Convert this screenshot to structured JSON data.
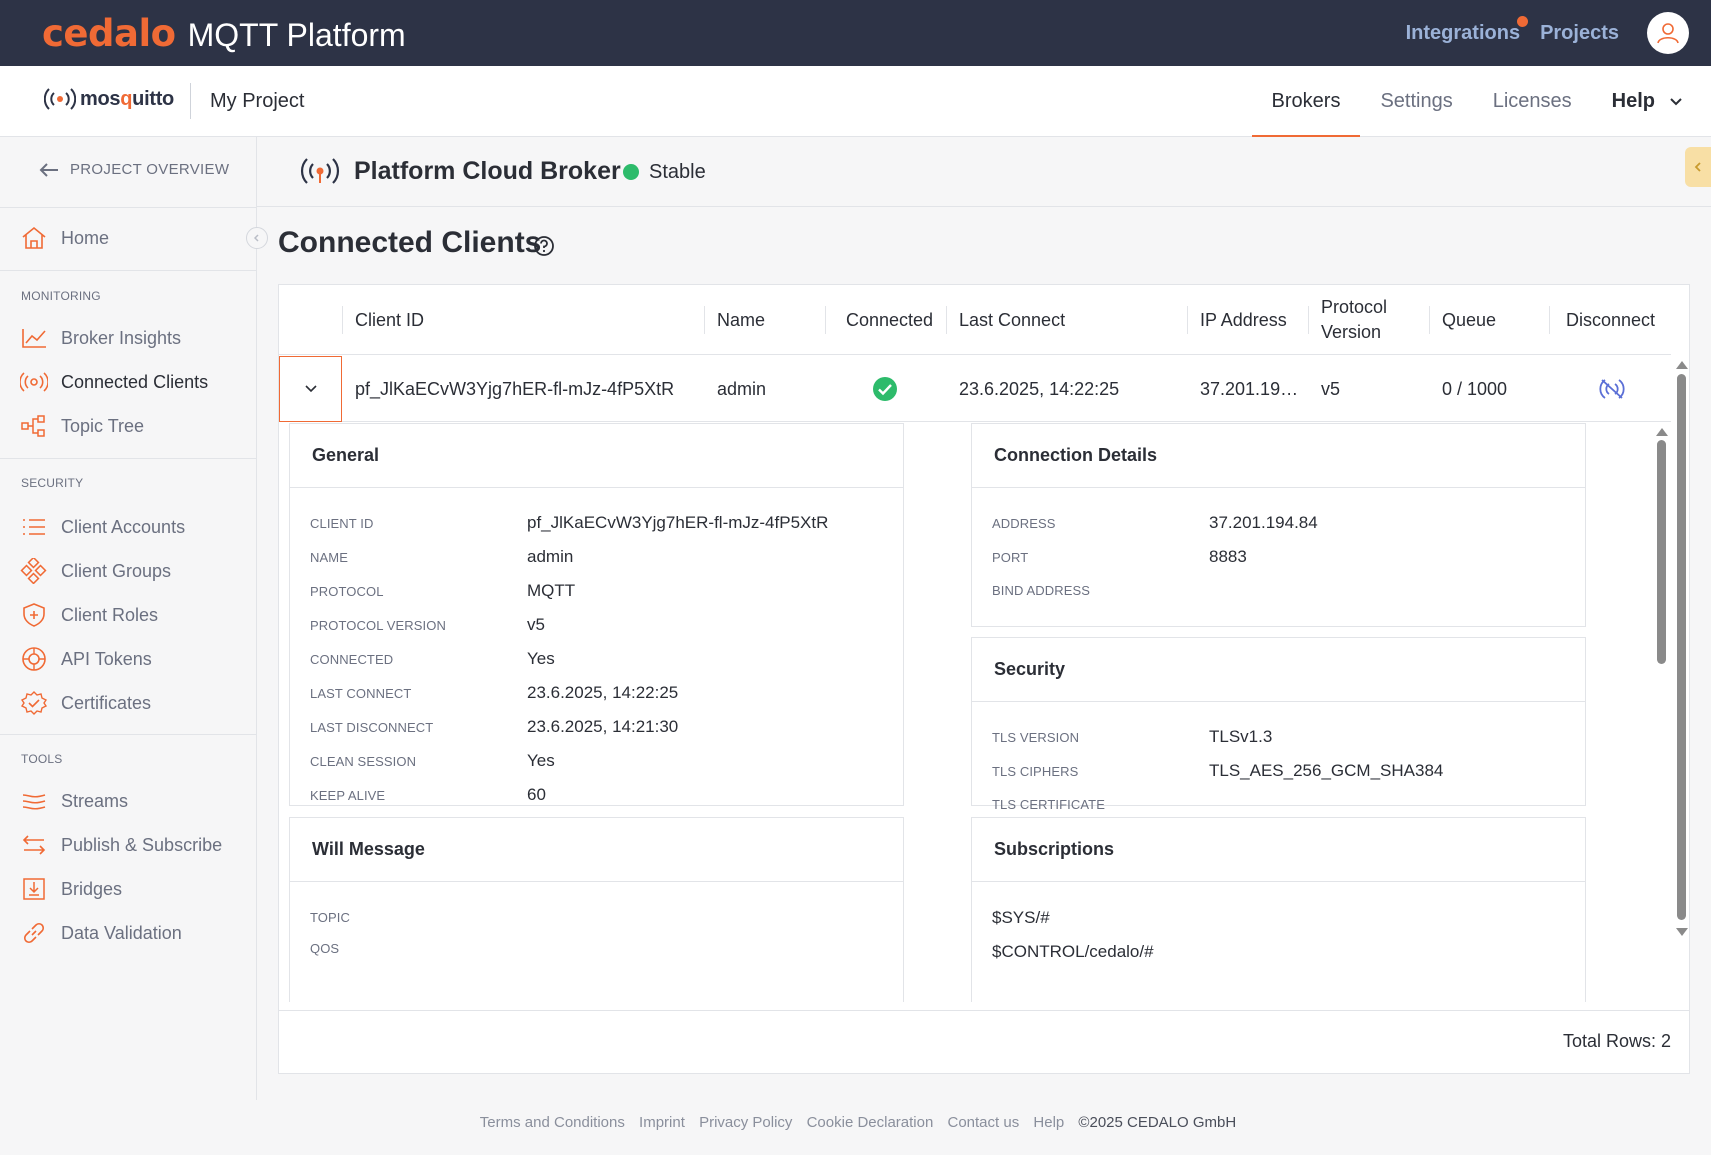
{
  "topbar": {
    "brand": "cedalo",
    "title": "MQTT Platform",
    "links": [
      "Integrations",
      "Projects"
    ],
    "notification_color": "#f06a35"
  },
  "subbar": {
    "logo_text_a": "mos",
    "logo_text_b": "q",
    "logo_text_c": "uitto",
    "project": "My Project",
    "tabs": [
      "Brokers",
      "Settings",
      "Licenses",
      "Help"
    ],
    "active_tab": "Brokers"
  },
  "sidebar": {
    "project_overview": "PROJECT OVERVIEW",
    "home": "Home",
    "sections": {
      "monitoring": "MONITORING",
      "security": "SECURITY",
      "tools": "TOOLS"
    },
    "items": [
      {
        "label": "Broker Insights",
        "icon": "chart-line-icon"
      },
      {
        "label": "Connected Clients",
        "icon": "signal-icon"
      },
      {
        "label": "Topic Tree",
        "icon": "tree-icon"
      },
      {
        "label": "Client Accounts",
        "icon": "list-icon"
      },
      {
        "label": "Client Groups",
        "icon": "groups-icon"
      },
      {
        "label": "Client Roles",
        "icon": "shield-icon"
      },
      {
        "label": "API Tokens",
        "icon": "token-icon"
      },
      {
        "label": "Certificates",
        "icon": "certificate-icon"
      },
      {
        "label": "Streams",
        "icon": "streams-icon"
      },
      {
        "label": "Publish & Subscribe",
        "icon": "arrows-icon"
      },
      {
        "label": "Bridges",
        "icon": "download-icon"
      },
      {
        "label": "Data Validation",
        "icon": "link-icon"
      }
    ]
  },
  "broker": {
    "name": "Platform Cloud Broker",
    "status": "Stable",
    "status_color": "#2dbb6b"
  },
  "page": {
    "title": "Connected Clients"
  },
  "table": {
    "headers": [
      "Client ID",
      "Name",
      "Connected",
      "Last Connect",
      "IP Address",
      "Protocol Version",
      "Queue",
      "Disconnect"
    ],
    "header_protocol_a": "Protocol",
    "header_protocol_b": "Version",
    "rows": [
      {
        "client_id": "pf_JlKaECvW3Yjg7hER-fl-mJz-4fP5XtR",
        "name": "admin",
        "connected": true,
        "last_connect": "23.6.2025, 14:22:25",
        "ip": "37.201.19…",
        "protocol_version": "v5",
        "queue": "0 / 1000"
      }
    ],
    "total_rows": "Total Rows: 2"
  },
  "details": {
    "general": {
      "title": "General",
      "fields": [
        {
          "key": "CLIENT ID",
          "value": "pf_JlKaECvW3Yjg7hER-fl-mJz-4fP5XtR"
        },
        {
          "key": "NAME",
          "value": "admin"
        },
        {
          "key": "PROTOCOL",
          "value": "MQTT"
        },
        {
          "key": "PROTOCOL VERSION",
          "value": "v5"
        },
        {
          "key": "CONNECTED",
          "value": "Yes"
        },
        {
          "key": "LAST CONNECT",
          "value": "23.6.2025, 14:22:25"
        },
        {
          "key": "LAST DISCONNECT",
          "value": "23.6.2025, 14:21:30"
        },
        {
          "key": "CLEAN SESSION",
          "value": "Yes"
        },
        {
          "key": "KEEP ALIVE",
          "value": "60"
        }
      ]
    },
    "connection": {
      "title": "Connection Details",
      "fields": [
        {
          "key": "ADDRESS",
          "value": "37.201.194.84"
        },
        {
          "key": "PORT",
          "value": "8883"
        },
        {
          "key": "BIND ADDRESS",
          "value": ""
        }
      ]
    },
    "security": {
      "title": "Security",
      "fields": [
        {
          "key": "TLS VERSION",
          "value": "TLSv1.3"
        },
        {
          "key": "TLS CIPHERS",
          "value": "TLS_AES_256_GCM_SHA384"
        },
        {
          "key": "TLS CERTIFICATE",
          "value": ""
        }
      ]
    },
    "will": {
      "title": "Will Message",
      "fields": [
        {
          "key": "TOPIC",
          "value": ""
        },
        {
          "key": "QOS",
          "value": ""
        }
      ]
    },
    "subscriptions": {
      "title": "Subscriptions",
      "items": [
        "$SYS/#",
        "$CONTROL/cedalo/#"
      ]
    }
  },
  "footer": {
    "links": [
      "Terms and Conditions",
      "Imprint",
      "Privacy Policy",
      "Cookie Declaration",
      "Contact us",
      "Help"
    ],
    "copyright": "©2025 CEDALO GmbH"
  }
}
